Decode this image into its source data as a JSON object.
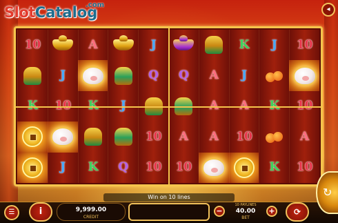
{
  "brand": {
    "logo_part1": "Slot",
    "logo_part2": "Catalog",
    "logo_suffix": ".com"
  },
  "reels": {
    "rows": [
      [
        "10",
        "ingot-gold",
        "A",
        "ingot-gold",
        "J",
        "ingot-purple",
        "figurine",
        "K",
        "J",
        "10"
      ],
      [
        "figurine",
        "J",
        "piggy-bank",
        "figurine",
        "Q",
        "Q",
        "A",
        "J",
        "orange",
        "piggy-bank"
      ],
      [
        "K",
        "10",
        "K",
        "J",
        "figurine",
        "figurine",
        "A",
        "A",
        "K",
        "10"
      ],
      [
        "coin",
        "piggy-bank",
        "figurine",
        "figurine",
        "10",
        "A",
        "A",
        "10",
        "orange",
        "A"
      ],
      [
        "coin",
        "J",
        "K",
        "Q",
        "10",
        "10",
        "piggy-bank",
        "coin",
        "K",
        "10"
      ]
    ]
  },
  "message": {
    "win_text": "Win on 10 lines"
  },
  "controls": {
    "menu_icon": "menu-icon",
    "info_label": "i",
    "credit_value": "9,999.00",
    "credit_label": "CREDIT",
    "minus_label": "−",
    "plus_label": "+",
    "bet_title": "10 PAYLINES",
    "bet_value": "40.00",
    "bet_label": "BET",
    "auto_icon": "autoplay-icon",
    "spin_icon": "spin-icon"
  },
  "colors": {
    "frame_gold": "#f5c54c",
    "reel_red": "#a0200c",
    "button_red": "#c2220f"
  }
}
